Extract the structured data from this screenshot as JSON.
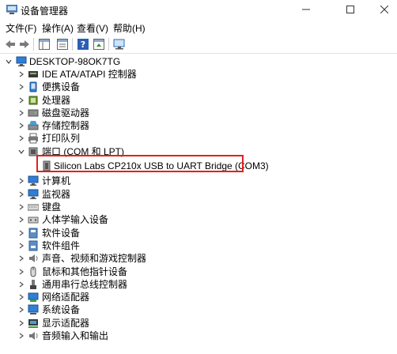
{
  "window": {
    "title": "设备管理器"
  },
  "menu": {
    "file": "文件(F)",
    "action": "操作(A)",
    "view": "查看(V)",
    "help": "帮助(H)"
  },
  "tree": {
    "root": "DESKTOP-98OK7TG",
    "categories": [
      {
        "label": "IDE ATA/ATAPI 控制器",
        "icon": "ide-icon",
        "expanded": false
      },
      {
        "label": "便携设备",
        "icon": "portable-device-icon",
        "expanded": false
      },
      {
        "label": "处理器",
        "icon": "processor-icon",
        "expanded": false
      },
      {
        "label": "磁盘驱动器",
        "icon": "disk-drive-icon",
        "expanded": false
      },
      {
        "label": "存储控制器",
        "icon": "storage-controller-icon",
        "expanded": false
      },
      {
        "label": "打印队列",
        "icon": "printer-icon",
        "expanded": false
      },
      {
        "label": "端口 (COM 和 LPT)",
        "icon": "port-icon",
        "expanded": true
      },
      {
        "label": "计算机",
        "icon": "computer-icon",
        "expanded": false
      },
      {
        "label": "监视器",
        "icon": "monitor-icon",
        "expanded": false
      },
      {
        "label": "键盘",
        "icon": "keyboard-icon",
        "expanded": false
      },
      {
        "label": "人体学输入设备",
        "icon": "hid-icon",
        "expanded": false
      },
      {
        "label": "软件设备",
        "icon": "software-device-icon",
        "expanded": false
      },
      {
        "label": "软件组件",
        "icon": "software-component-icon",
        "expanded": false
      },
      {
        "label": "声音、视频和游戏控制器",
        "icon": "sound-icon",
        "expanded": false
      },
      {
        "label": "鼠标和其他指针设备",
        "icon": "mouse-icon",
        "expanded": false
      },
      {
        "label": "通用串行总线控制器",
        "icon": "usb-icon",
        "expanded": false
      },
      {
        "label": "网络适配器",
        "icon": "network-icon",
        "expanded": false
      },
      {
        "label": "系统设备",
        "icon": "system-device-icon",
        "expanded": false
      },
      {
        "label": "显示适配器",
        "icon": "display-adapter-icon",
        "expanded": false
      },
      {
        "label": "音频输入和输出",
        "icon": "audio-io-icon",
        "expanded": false
      }
    ],
    "port_child": "Silicon Labs CP210x USB to UART Bridge (COM3)"
  },
  "colors": {
    "highlight": "#e0211d",
    "icon_blue": "#1e73be"
  }
}
